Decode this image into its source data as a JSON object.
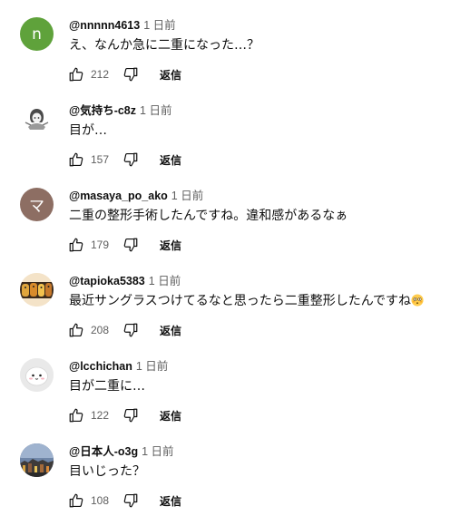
{
  "labels": {
    "reply": "返信"
  },
  "comments": [
    {
      "author": "@nnnnn4613",
      "time": "1 日前",
      "text": "え、なんか急に二重になった…？",
      "likes": "212",
      "avatar": {
        "type": "letter",
        "letter": "n",
        "color": "#5fa23b"
      }
    },
    {
      "author": "@気持ち-c8z",
      "time": "1 日前",
      "text": "目が…",
      "likes": "157",
      "avatar": {
        "type": "image",
        "icon": "anime-character-avatar"
      }
    },
    {
      "author": "@masaya_po_ako",
      "time": "1 日前",
      "text": "二重の整形手術したんですね。違和感があるなぁ",
      "likes": "179",
      "avatar": {
        "type": "letter",
        "letter": "マ",
        "color": "#8d6e63"
      }
    },
    {
      "author": "@tapioka5383",
      "time": "1 日前",
      "text": "最近サングラスつけてるなと思ったら二重整形したんですね",
      "text_emoji": "flushed-face-emoji",
      "likes": "208",
      "avatar": {
        "type": "image",
        "icon": "figurines-avatar"
      }
    },
    {
      "author": "@lcchichan",
      "time": "1 日前",
      "text": "目が二重に…",
      "likes": "122",
      "avatar": {
        "type": "image",
        "icon": "white-mascot-avatar"
      }
    },
    {
      "author": "@日本人-o3g",
      "time": "1 日前",
      "text": "目いじった？",
      "likes": "108",
      "avatar": {
        "type": "image",
        "icon": "city-night-avatar"
      }
    }
  ],
  "icons": {
    "like": "thumbs-up-icon",
    "dislike": "thumbs-down-icon"
  }
}
